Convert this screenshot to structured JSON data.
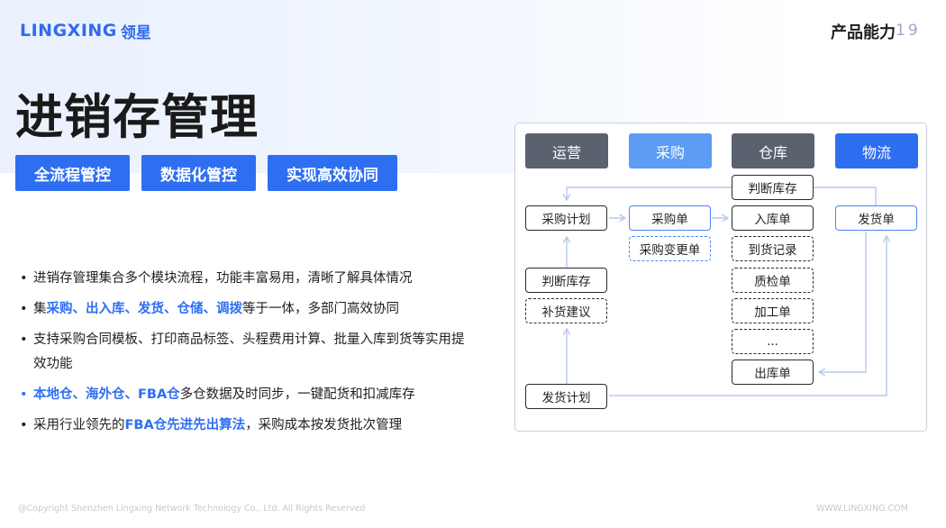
{
  "header": {
    "logo_text": "LINGXING",
    "logo_cn": "领星",
    "section": "产品能力",
    "page_number": "19"
  },
  "title": "进销存管理",
  "tags": [
    "全流程管控",
    "数据化管控",
    "实现高效协同"
  ],
  "bullets": [
    {
      "segments": [
        {
          "text": "进销存管理集合多个模块流程，功能丰富易用，清晰了解具体情况",
          "hl": false
        }
      ]
    },
    {
      "segments": [
        {
          "text": "集",
          "hl": false
        },
        {
          "text": "采购、出入库、发货、仓储、调拨",
          "hl": true
        },
        {
          "text": "等于一体，多部门高效协同",
          "hl": false
        }
      ]
    },
    {
      "segments": [
        {
          "text": "支持采购合同模板、打印商品标签、头程费用计算、批量入库到货等实用提效功能",
          "hl": false
        }
      ]
    },
    {
      "segments": [
        {
          "text": "本地仓、海外仓、FBA仓",
          "hl": true
        },
        {
          "text": "多仓数据及时同步，一键配货和扣减库存",
          "hl": false
        }
      ]
    },
    {
      "segments": [
        {
          "text": "采用行业领先的",
          "hl": false
        },
        {
          "text": "FBA仓先进先出算法",
          "hl": true
        },
        {
          "text": "，采购成本按发货批次管理",
          "hl": false
        }
      ]
    }
  ],
  "diagram": {
    "columns": [
      "运营",
      "采购",
      "仓库",
      "物流"
    ],
    "nodes": {
      "ops_purchase_plan": "采购计划",
      "ops_judge_stock": "判断库存",
      "ops_restock": "补货建议",
      "ops_ship_plan": "发货计划",
      "pur_order": "采购单",
      "pur_change": "采购变更单",
      "wh_judge_stock": "判断库存",
      "wh_inbound": "入库单",
      "wh_arrival": "到货记录",
      "wh_qc": "质检单",
      "wh_process": "加工单",
      "wh_more": "...",
      "wh_outbound": "出库单",
      "log_ship_order": "发货单"
    }
  },
  "footer": {
    "copyright": "@Copyright Shenzhen Lingxing Network Technology Co., Ltd. All Rights Reserved",
    "url": "WWW.LINGXING.COM"
  },
  "colors": {
    "brand": "#2e6ff2",
    "header_gray": "#5a6270",
    "header_light": "#5c9cf5",
    "arrow": "#b7c8ee"
  }
}
